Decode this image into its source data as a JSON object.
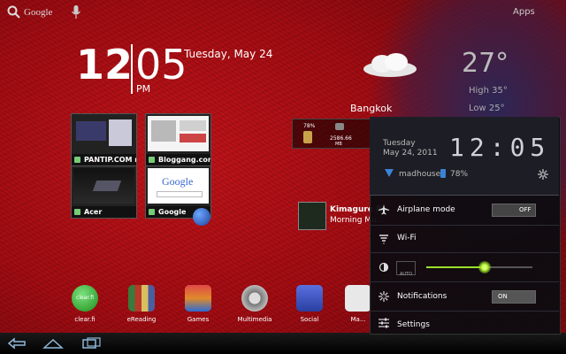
{
  "topbar": {
    "search_label": "Google",
    "apps_label": "Apps"
  },
  "clock": {
    "hour": "12",
    "minute": "05",
    "ampm": "PM",
    "date": "Tuesday, May 24"
  },
  "weather": {
    "city": "Bangkok",
    "temp": "27°",
    "high": "High 35°",
    "low": "Low 25°"
  },
  "storage": {
    "percent": "78%",
    "size": "2586.66",
    "unit": "MB"
  },
  "bookmarks": [
    {
      "label": "PANTIP.COM n..."
    },
    {
      "label": "Bloggang.com..."
    },
    {
      "label": "Acer"
    },
    {
      "label": "Google",
      "search_logo": "Google"
    }
  ],
  "music": {
    "title": "Kimagure P...",
    "subtitle": "Morning Mu..."
  },
  "dock": [
    {
      "label": "clear.fi",
      "icon": "clearfi-icon",
      "icon_text": "clear.fi"
    },
    {
      "label": "eReading",
      "icon": "books-icon"
    },
    {
      "label": "Games",
      "icon": "games-icon"
    },
    {
      "label": "Multimedia",
      "icon": "film-icon"
    },
    {
      "label": "Social",
      "icon": "social-icon"
    },
    {
      "label": "Ma...",
      "icon": "mail-icon"
    }
  ],
  "panel": {
    "time": "12:05",
    "day": "Tuesday",
    "date": "May 24, 2011",
    "wifi_name": "madhouse",
    "battery": "78%",
    "airplane_label": "Airplane mode",
    "airplane_state": "OFF",
    "wifi_label": "Wi-Fi",
    "auto_label": "AUTO",
    "brightness_level": 0.55,
    "notifications_label": "Notifications",
    "notifications_state": "ON",
    "settings_label": "Settings"
  },
  "colors": {
    "wallpaper": "#b5101a",
    "accent_green": "#9be02a",
    "battery_blue": "#3b83d6"
  }
}
